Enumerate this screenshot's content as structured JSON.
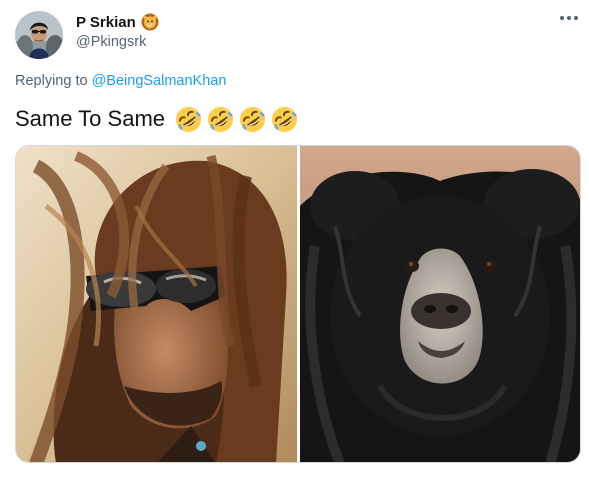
{
  "tweet": {
    "display_name": "P Srkian",
    "name_badge_icon": "lion-face-icon",
    "handle": "@Pkingsrk",
    "more_icon": "more-horizontal-icon",
    "replying_prefix": "Replying to",
    "replying_to": "@BeingSalmanKhan",
    "text": "Same To Same",
    "emoji_icon": "rolling-on-floor-laughing-icon",
    "emoji_count": 4,
    "media": [
      {
        "icon": "man-long-hair-sunglasses-photo"
      },
      {
        "icon": "sloth-bear-photo"
      }
    ]
  },
  "colors": {
    "text": "#0f1419",
    "secondary": "#536471",
    "link": "#1d9bf0",
    "border": "#cfd9de"
  }
}
